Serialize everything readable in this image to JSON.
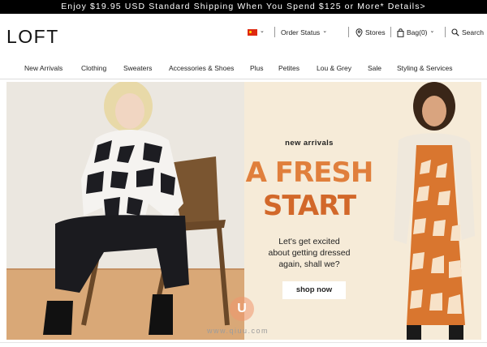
{
  "promo": {
    "text": "Enjoy $19.95 USD Standard Shipping When You Spend $125 or More* Details>"
  },
  "header": {
    "logo": "LOFT",
    "order_status": "Order Status",
    "stores": "Stores",
    "bag": "Bag(0)",
    "search": "Search"
  },
  "icons": [
    "china-flag-icon",
    "chevron-down-icon",
    "location-pin-icon",
    "shopping-bag-icon",
    "search-icon"
  ],
  "nav": {
    "items": [
      "New Arrivals",
      "Clothing",
      "Sweaters",
      "Accessories & Shoes",
      "Plus",
      "Petites",
      "Lou & Grey",
      "Sale",
      "Styling & Services"
    ]
  },
  "hero": {
    "eyebrow": "new arrivals",
    "headline_1": "A FRESH",
    "headline_2": "START",
    "body_1": "Let's get excited",
    "body_2": "about getting dressed",
    "body_3": "again, shall we?",
    "cta": "shop now"
  },
  "watermark": {
    "text": "www.qiuu.com",
    "logo": "U"
  },
  "colors": {
    "promo_bg": "#000000",
    "headline": "#e07f3c",
    "hero_panel": "#f6ebd8"
  }
}
